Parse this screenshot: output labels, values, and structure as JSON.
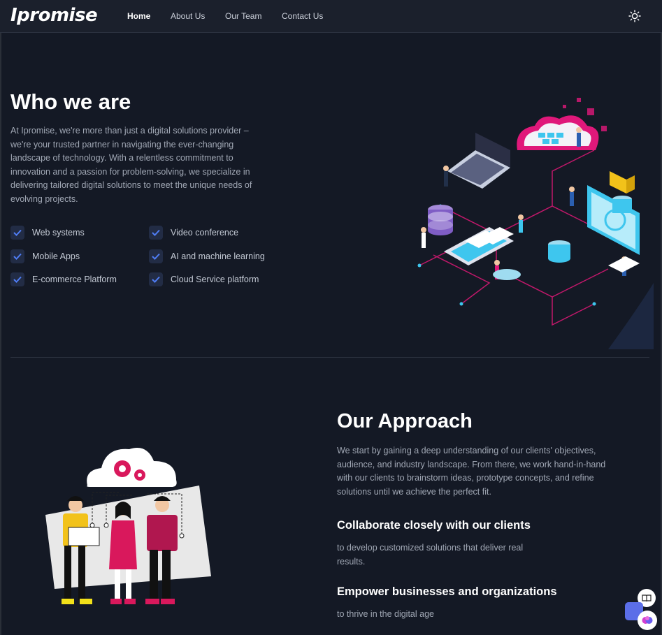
{
  "brand": {
    "logo_text": "Ipromise"
  },
  "nav": {
    "links": [
      {
        "label": "Home",
        "active": true
      },
      {
        "label": "About Us"
      },
      {
        "label": "Our Team"
      },
      {
        "label": "Contact Us"
      }
    ],
    "theme_icon": "sun-icon"
  },
  "who": {
    "title": "Who we are",
    "text": "At Ipromise, we're more than just a digital solutions provider – we're your trusted partner in navigating the ever-changing landscape of technology. With a relentless commitment to innovation and a passion for problem-solving, we specialize in delivering tailored digital solutions to meet the unique needs of evolving projects.",
    "features": [
      "Web systems",
      "Video conference",
      "Mobile Apps",
      "AI and machine learning",
      "E-commerce Platform",
      "Cloud Service platform"
    ]
  },
  "approach": {
    "title": "Our Approach",
    "text": "We start by gaining a deep understanding of our clients' objectives, audience, and industry landscape. From there, we work hand-in-hand with our clients to brainstorm ideas, prototype concepts, and refine solutions until we achieve the perfect fit.",
    "points": [
      {
        "title": "Collaborate closely with our clients",
        "text": "to develop customized solutions that deliver real results."
      },
      {
        "title": "Empower businesses and organizations",
        "text": "to thrive in the digital age"
      }
    ]
  },
  "colors": {
    "background": "#141925",
    "nav_background": "#1b202c",
    "accent_magenta": "#e0187a",
    "accent_cyan": "#3ec6ee",
    "check_blue": "#4f7df5"
  }
}
